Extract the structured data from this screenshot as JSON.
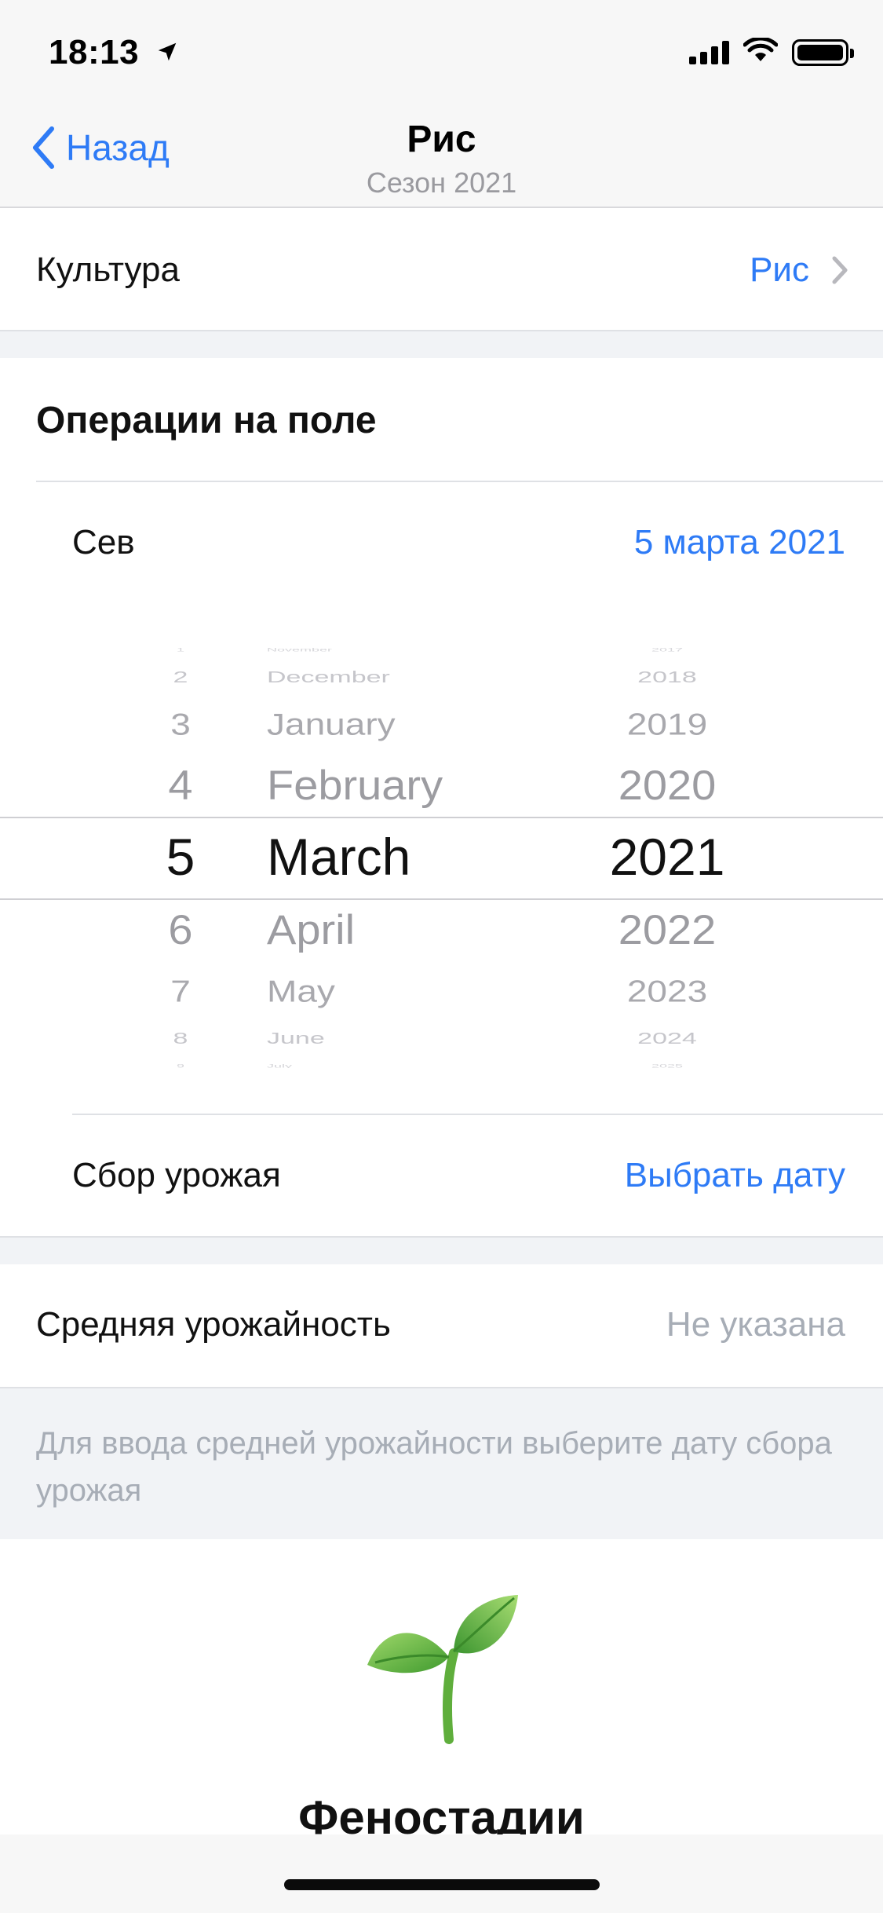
{
  "status": {
    "time": "18:13"
  },
  "nav": {
    "back_label": "Назад",
    "title": "Рис",
    "subtitle": "Сезон 2021"
  },
  "culture": {
    "label": "Культура",
    "value": "Рис"
  },
  "operations": {
    "title": "Операции на поле",
    "sowing": {
      "label": "Сев",
      "value": "5 марта 2021"
    },
    "harvest": {
      "label": "Сбор урожая",
      "value": "Выбрать дату"
    }
  },
  "picker": {
    "days": [
      "1",
      "2",
      "3",
      "4",
      "5",
      "6",
      "7",
      "8",
      "9"
    ],
    "months": [
      "November",
      "December",
      "January",
      "February",
      "March",
      "April",
      "May",
      "June",
      "July"
    ],
    "years": [
      "2017",
      "2018",
      "2019",
      "2020",
      "2021",
      "2022",
      "2023",
      "2024",
      "2025"
    ],
    "selected": {
      "day": "5",
      "month": "March",
      "year": "2021"
    }
  },
  "yield": {
    "label": "Средняя урожайность",
    "value": "Не указана"
  },
  "hint": "Для ввода средней урожайности выберите дату сбора урожая",
  "phenostages": {
    "icon": "seedling-icon",
    "title": "Феностадии"
  },
  "colors": {
    "accent": "#2e7bf6",
    "muted": "#9a9a9f",
    "band": "#f1f3f6"
  }
}
